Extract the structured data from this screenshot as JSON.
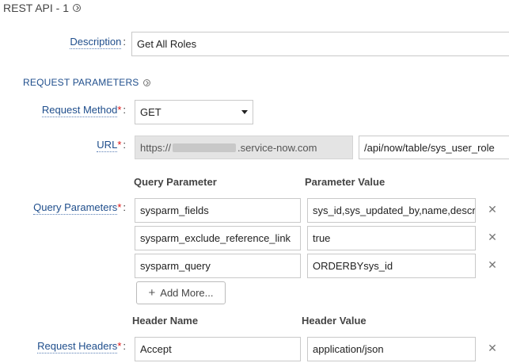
{
  "header": {
    "title": "REST API - 1"
  },
  "description": {
    "label": "Description",
    "colon": ":",
    "value": "Get All Roles"
  },
  "section": {
    "title": "REQUEST PARAMETERS"
  },
  "method": {
    "label": "Request Method",
    "required_mark": "*",
    "colon": ":",
    "value": "GET"
  },
  "url": {
    "label": "URL",
    "required_mark": "*",
    "colon": ":",
    "host_prefix": "https://",
    "host_suffix": ".service-now.com",
    "path": "/api/now/table/sys_user_role"
  },
  "query": {
    "label": "Query Parameters",
    "required_mark": "*",
    "colon": ":",
    "col_name": "Query Parameter",
    "col_value": "Parameter Value",
    "rows": [
      {
        "name": "sysparm_fields",
        "value": "sys_id,sys_updated_by,name,description"
      },
      {
        "name": "sysparm_exclude_reference_link",
        "value": "true"
      },
      {
        "name": "sysparm_query",
        "value": "ORDERBYsys_id"
      }
    ],
    "remove_icon": "close-icon",
    "add_more": "Add More..."
  },
  "headers": {
    "label": "Request Headers",
    "required_mark": "*",
    "colon": ":",
    "col_name": "Header Name",
    "col_value": "Header Value",
    "rows": [
      {
        "name": "Accept",
        "value": "application/json"
      }
    ]
  }
}
